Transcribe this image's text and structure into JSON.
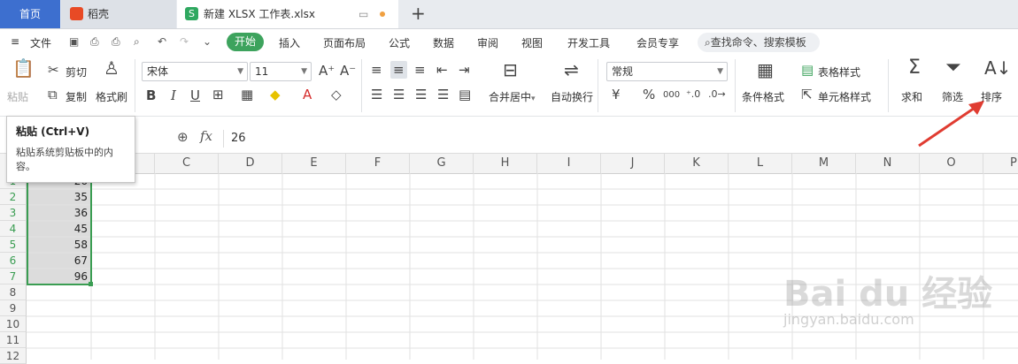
{
  "tabs": {
    "home": "首页",
    "daoke": "稻壳",
    "doc": "新建 XLSX 工作表.xlsx",
    "new_tab": "+"
  },
  "menu": {
    "file": "文件",
    "start": "开始",
    "insert": "插入",
    "layout": "页面布局",
    "formula": "公式",
    "data": "数据",
    "review": "审阅",
    "view": "视图",
    "devtools": "开发工具",
    "member": "会员专享",
    "search": "查找命令、搜索模板"
  },
  "ribbon": {
    "paste": "粘贴",
    "cut": "剪切",
    "copy": "复制",
    "format_painter": "格式刷",
    "font_name": "宋体",
    "font_size": "11",
    "bold": "B",
    "italic": "I",
    "underline": "U",
    "merge_center": "合并居中",
    "wrap_text": "自动换行",
    "number_format": "常规",
    "currency": "¥",
    "percent": "%",
    "thousands": "000",
    "cond_format": "条件格式",
    "table_style": "表格样式",
    "cell_style": "单元格样式",
    "sum": "求和",
    "filter": "筛选",
    "sort": "排序"
  },
  "tooltip": {
    "title": "粘贴 (Ctrl+V)",
    "desc": "粘贴系统剪贴板中的内容。"
  },
  "formula_bar": {
    "fx": "fx",
    "value": "26"
  },
  "columns": [
    "C",
    "D",
    "E",
    "F",
    "G",
    "H",
    "I",
    "J",
    "K",
    "L",
    "M",
    "N",
    "O",
    "P"
  ],
  "rows": [
    "1",
    "2",
    "3",
    "4",
    "5",
    "6",
    "7",
    "8",
    "9",
    "10",
    "11",
    "12"
  ],
  "cells_b": [
    "26",
    "35",
    "36",
    "45",
    "58",
    "67",
    "96"
  ],
  "watermark": {
    "brand": "Bai du 经验",
    "url": "jingyan.baidu.com"
  },
  "colors": {
    "accent_green": "#3da35d",
    "tab_blue": "#3d6fcf",
    "selection": "#dcdcdc",
    "arrow_red": "#e03c31"
  }
}
